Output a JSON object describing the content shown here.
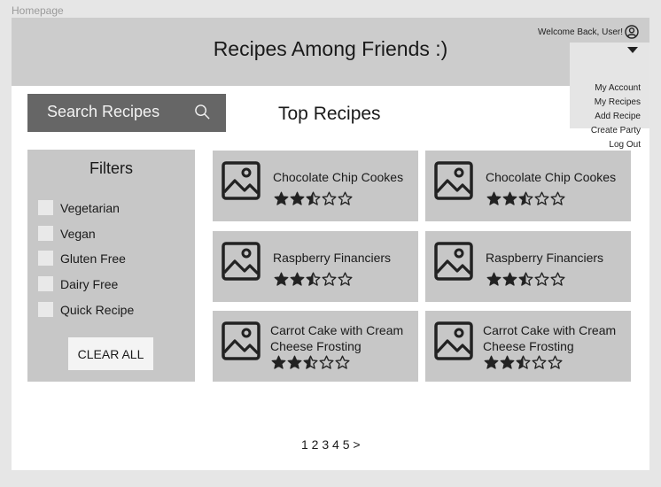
{
  "frame_label": "Homepage",
  "header": {
    "title": "Recipes Among Friends :)",
    "welcome": "Welcome Back, User!",
    "menu": [
      "My Account",
      "My Recipes",
      "Add Recipe",
      "Create Party",
      "Log Out"
    ]
  },
  "search": {
    "label": "Search Recipes"
  },
  "top_recipes_title": "Top Recipes",
  "filters": {
    "title": "Filters",
    "options": [
      "Vegetarian",
      "Vegan",
      "Gluten Free",
      "Dairy Free",
      "Quick Recipe"
    ],
    "clear_label": "CLEAR ALL"
  },
  "recipes": [
    {
      "title": "Chocolate Chip Cookes",
      "rating": 2.5
    },
    {
      "title": "Chocolate Chip Cookes",
      "rating": 2.5
    },
    {
      "title": "Raspberry Financiers",
      "rating": 2.5
    },
    {
      "title": "Raspberry Financiers",
      "rating": 2.5
    },
    {
      "title": "Carrot Cake with Cream Cheese Frosting",
      "rating": 2.5
    },
    {
      "title": "Carrot Cake with Cream Cheese Frosting",
      "rating": 2.5
    }
  ],
  "pagination": {
    "pages": "1 2 3 4 5",
    "next": ">"
  }
}
